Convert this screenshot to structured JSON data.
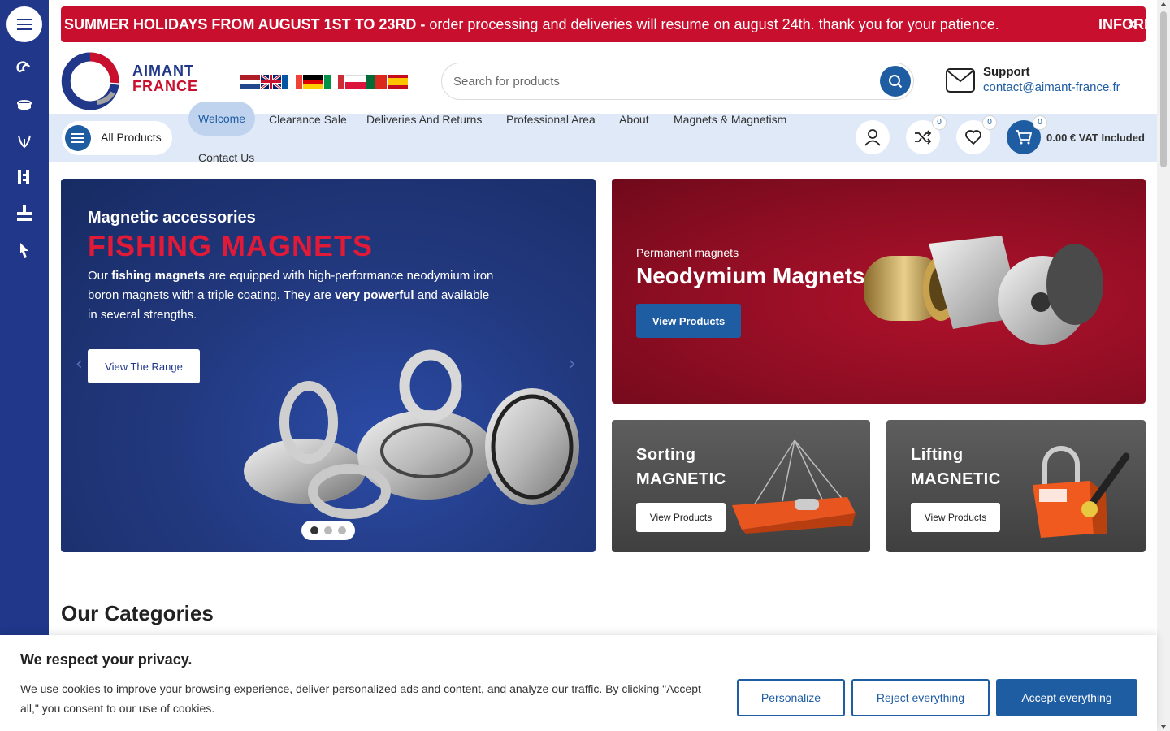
{
  "announcement": {
    "bold": "SUMMER HOLIDAYS FROM AUGUST 1ST TO 23RD -",
    "text": " order processing and deliveries will resume on august 24th. thank you for your patience.",
    "next": "INFORI",
    "close": "×"
  },
  "logo": {
    "line1": "AIMANT",
    "line2": "FRANCE"
  },
  "search": {
    "placeholder": "Search for products"
  },
  "support": {
    "label": "Support",
    "email": "contact@aimant-france.fr"
  },
  "nav": {
    "all_products": "All Products",
    "links": [
      "Welcome",
      "Clearance Sale",
      "Deliveries And Returns",
      "Professional Area",
      "About",
      "Magnets & Magnetism",
      "Contact Us"
    ]
  },
  "header_icons": {
    "compare_count": "0",
    "wishlist_count": "0",
    "cart_count": "0",
    "cart_total": "0.00 € VAT Included"
  },
  "hero": {
    "subtitle": "Magnetic accessories",
    "title": "FISHING MAGNETS",
    "desc_1": "Our ",
    "desc_bold_1": "fishing magnets",
    "desc_2": " are equipped with high-performance neodymium iron boron magnets with a triple coating. They are ",
    "desc_bold_2": "very powerful",
    "desc_3": " and available in several strengths.",
    "button": "View The Range",
    "slides": 3,
    "active_slide": 1
  },
  "promo_neodymium": {
    "subtitle": "Permanent magnets",
    "title": "Neodymium Magnets",
    "button": "View Products"
  },
  "promo_sorting": {
    "title_1": "Sorting",
    "title_2": "MAGNETIC",
    "button": "View Products"
  },
  "promo_lifting": {
    "title_1": "Lifting",
    "title_2": "MAGNETIC",
    "button": "View Products"
  },
  "categories": {
    "title": "Our Categories"
  },
  "cookie": {
    "title": "We respect your privacy.",
    "text": "We use cookies to improve your browsing experience, deliver personalized ads and content, and analyze our traffic. By clicking \"Accept all,\" you consent to our use of cookies.",
    "personalize": "Personalize",
    "reject": "Reject everything",
    "accept": "Accept everything"
  },
  "colors": {
    "primary": "#1f5da3",
    "navy": "#20378a",
    "red": "#c8102e",
    "nav_band": "#dfe9f8"
  },
  "flags": [
    "netherlands",
    "united-kingdom",
    "france",
    "germany",
    "italy",
    "poland",
    "portugal",
    "spain"
  ]
}
